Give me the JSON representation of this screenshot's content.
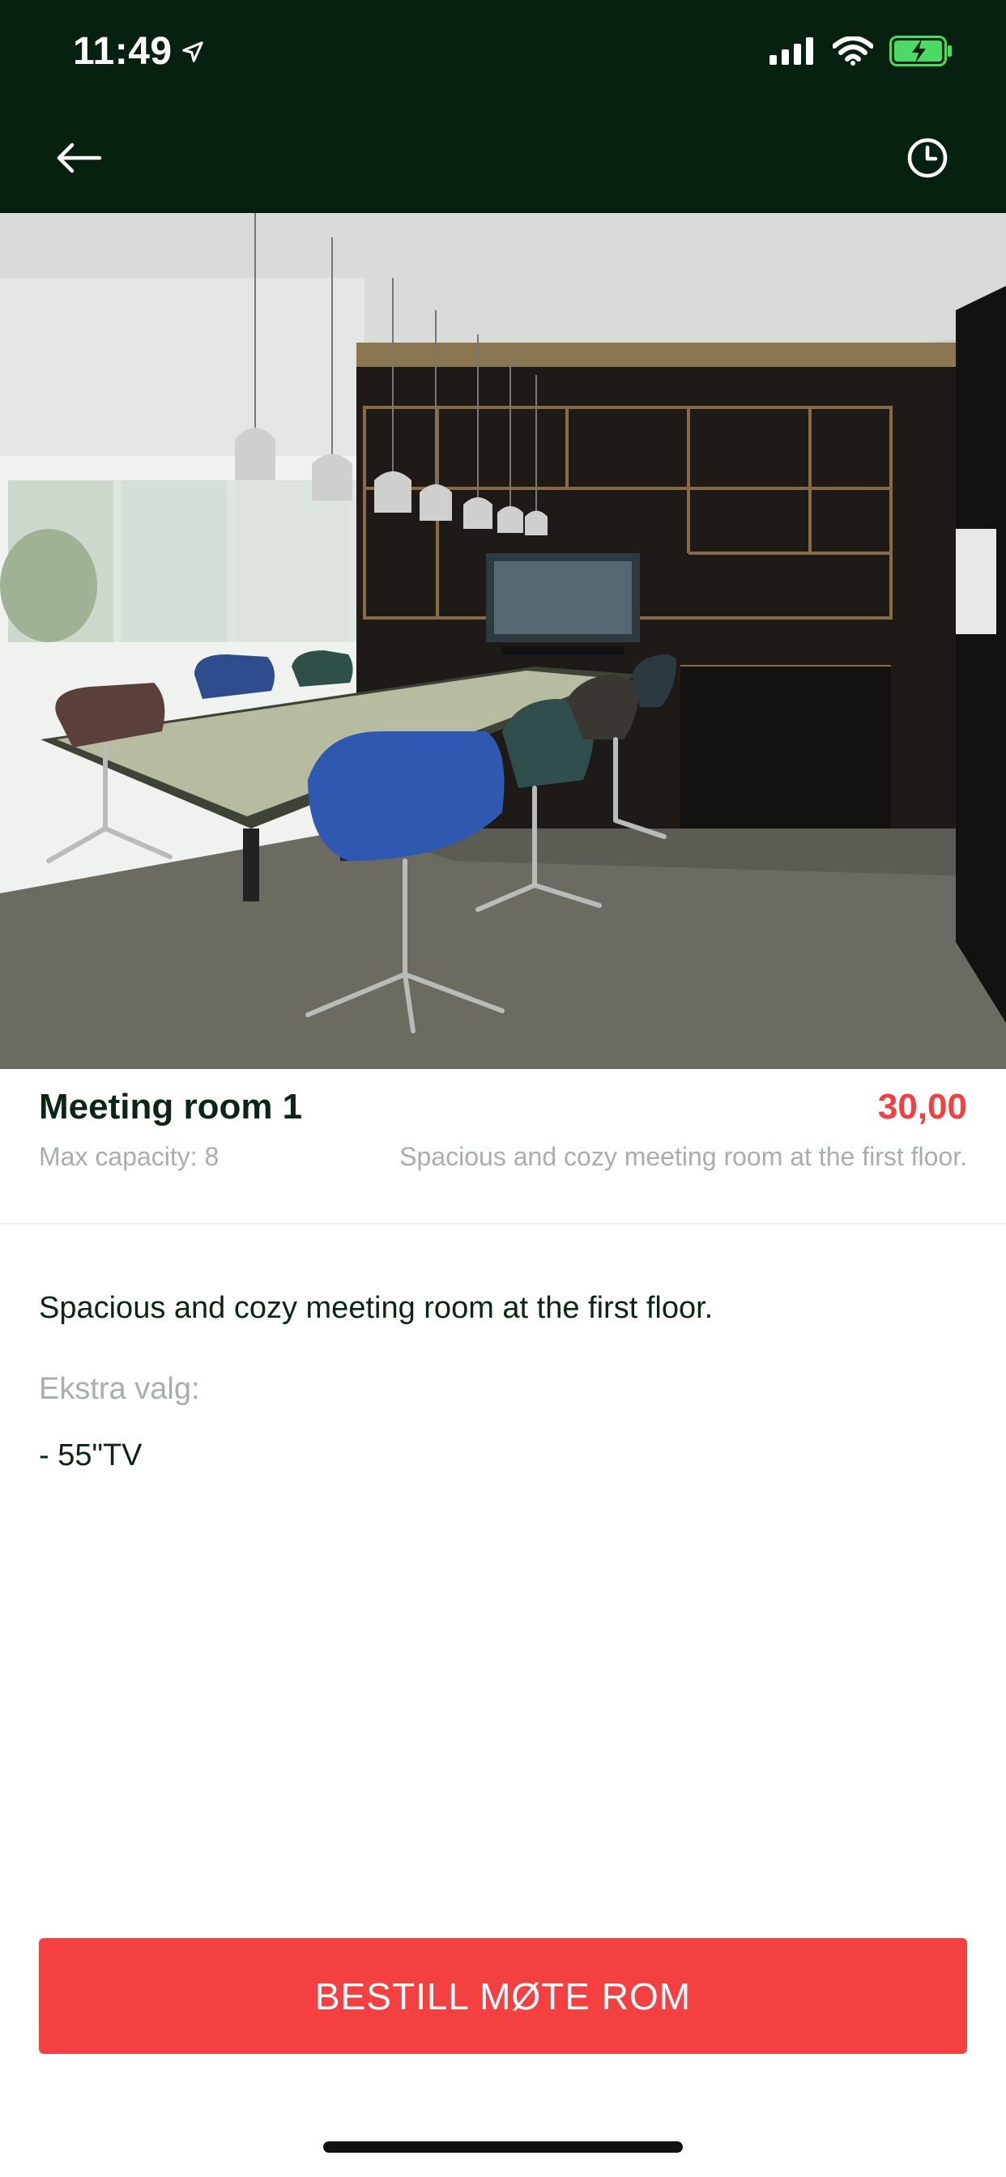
{
  "status_bar": {
    "time": "11:49",
    "icons": [
      "location-arrow-icon",
      "cellular-signal-icon",
      "wifi-icon",
      "battery-charging-icon"
    ]
  },
  "nav": {
    "back_icon": "arrow-left-icon",
    "history_icon": "clock-icon"
  },
  "hero": {
    "image_subject": "meeting room with long table, chairs, pendant lamps and shelves"
  },
  "room": {
    "title": "Meeting room 1",
    "price": "30,00",
    "capacity": "Max capacity: 8",
    "subtitle": "Spacious and cozy meeting room at the first floor."
  },
  "details": {
    "description": "Spacious and cozy meeting room at the first floor.",
    "extras_label": "Ekstra valg:",
    "extras": [
      "- 55\"TV"
    ]
  },
  "action": {
    "book_label": "BESTILL MØTE ROM"
  },
  "colors": {
    "header_bg": "#06210f",
    "accent": "#f54042",
    "price": "#f23f41",
    "text_dark": "#0b2615",
    "text_muted": "#a9aeac"
  }
}
